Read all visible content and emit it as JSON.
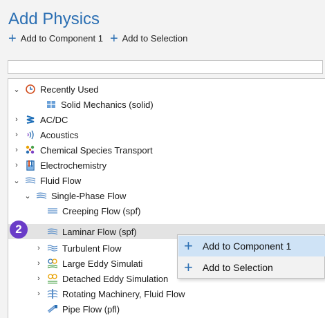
{
  "header": {
    "title": "Add Physics",
    "add_component": "Add to Component 1",
    "add_selection": "Add to Selection"
  },
  "search": {
    "value": ""
  },
  "tree": {
    "recently_used": "Recently Used",
    "solid_mechanics": "Solid Mechanics (solid)",
    "acdc": "AC/DC",
    "acoustics": "Acoustics",
    "chemical": "Chemical Species Transport",
    "electrochem": "Electrochemistry",
    "fluid_flow": "Fluid Flow",
    "single_phase": "Single-Phase Flow",
    "creeping": "Creeping Flow (spf)",
    "laminar": "Laminar Flow (spf)",
    "turbulent": "Turbulent Flow",
    "les": "Large Eddy Simulati",
    "des": "Detached Eddy Simulation",
    "rotating": "Rotating Machinery, Fluid Flow",
    "pipe": "Pipe Flow (pfl)"
  },
  "badge": "2",
  "context_menu": {
    "item1": "Add to Component 1",
    "item2": "Add to Selection"
  },
  "colors": {
    "accent": "#2b6fb3",
    "badge": "#6a3cc8",
    "highlight": "#cfe3f6"
  }
}
